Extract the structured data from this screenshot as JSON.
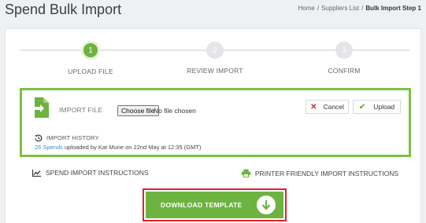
{
  "header": {
    "title": "Spend Bulk Import",
    "breadcrumb": [
      {
        "label": "Home",
        "sep": "/"
      },
      {
        "label": "Suppliers List",
        "sep": "/"
      },
      {
        "label": "Bulk Import Step 1"
      }
    ]
  },
  "steps": [
    {
      "number": "1",
      "label": "UPLOAD FILE",
      "state": "active"
    },
    {
      "number": "2",
      "label": "REVIEW IMPORT",
      "state": "inactive"
    },
    {
      "number": "3",
      "label": "CONFIRM",
      "state": "inactive"
    }
  ],
  "import": {
    "label": "IMPORT FILE",
    "choose_label": "Choose file",
    "file_status": "No file chosen",
    "cancel_label": "Cancel",
    "upload_label": "Upload"
  },
  "history": {
    "title": "IMPORT HISTORY",
    "link_text": "26 Spends",
    "detail": "uploaded by Kat Murie on 22nd May at 12:35 (GMT)"
  },
  "links": {
    "instructions": "SPEND IMPORT INSTRUCTIONS",
    "printer": "PRINTER FRIENDLY IMPORT INSTRUCTIONS"
  },
  "download": {
    "label": "DOWNLOAD TEMPLATE"
  },
  "colors": {
    "accent_green": "#6db33f",
    "highlight_red": "#e0222a",
    "link_blue": "#3a8fd6"
  }
}
